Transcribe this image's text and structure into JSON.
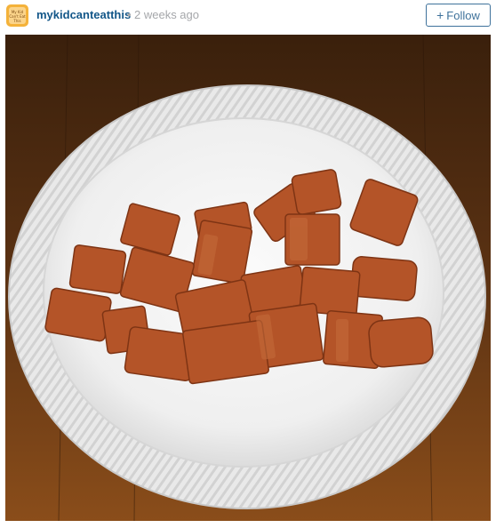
{
  "post": {
    "username": "mykidcanteatthis",
    "separator": "•",
    "timestamp": "2 weeks ago",
    "follow_label": "Follow",
    "follow_icon": "+",
    "avatar_text": "My Kid Can't Eat This"
  },
  "photo": {
    "subject": "white foam plate with cut hot dog pieces on wooden table",
    "colors": {
      "table": "#6b3c16",
      "plate": "#f4f4f4",
      "hotdog": "#b8542a"
    }
  }
}
